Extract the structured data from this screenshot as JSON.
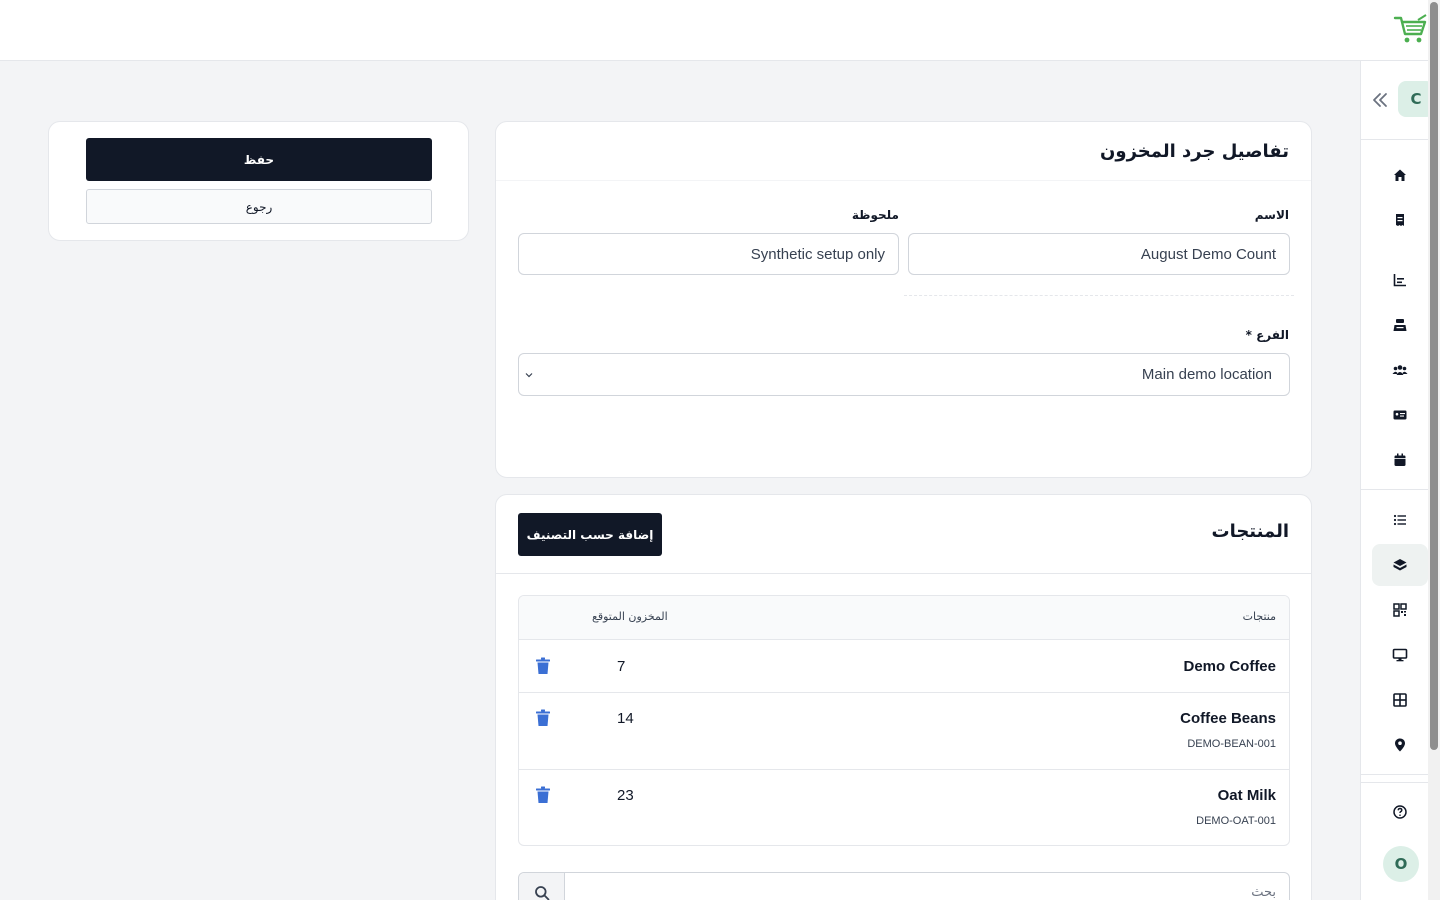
{
  "app": {
    "user_initial": "O",
    "org_initial": "C"
  },
  "actions": {
    "save_label": "حفظ",
    "back_label": "رجوع"
  },
  "details": {
    "title": "تفاصيل جرد المخزون",
    "name_label": "الاسم",
    "name_value": "August Demo Count",
    "note_label": "ملحوظة",
    "note_value": "Synthetic setup only",
    "branch_label": "الفرع *",
    "branch_value": "Main demo location"
  },
  "products": {
    "title": "المنتجات",
    "add_by_category_label": "إضافة حسب التصنيف",
    "columns": {
      "product": "منتجات",
      "expected_stock": "المخزون المتوقع"
    },
    "rows": [
      {
        "name": "Demo Coffee",
        "sku": "",
        "expected": "7"
      },
      {
        "name": "Coffee Beans",
        "sku": "DEMO-BEAN-001",
        "expected": "14"
      },
      {
        "name": "Oat Milk",
        "sku": "DEMO-OAT-001",
        "expected": "23"
      }
    ],
    "search_placeholder": "بحث"
  },
  "sidebar": {
    "items": [
      {
        "icon": "home-icon"
      },
      {
        "icon": "receipt-icon"
      },
      {
        "icon": "chart-icon"
      },
      {
        "icon": "cash-register-icon"
      },
      {
        "icon": "users-icon"
      },
      {
        "icon": "id-card-icon"
      },
      {
        "icon": "calendar-icon"
      },
      {
        "icon": "list-icon",
        "section": 2
      },
      {
        "icon": "inventory-box-icon",
        "active": true
      },
      {
        "icon": "qrcode-icon"
      },
      {
        "icon": "monitor-icon"
      },
      {
        "icon": "table-grid-icon"
      },
      {
        "icon": "location-pin-icon"
      },
      {
        "icon": "help-circle-icon",
        "section": 3
      }
    ]
  },
  "colors": {
    "accent_green": "#4caf50",
    "dark_button": "#111827",
    "trash_blue": "#3b6fd4",
    "avatar_bg": "#dcefe7"
  }
}
